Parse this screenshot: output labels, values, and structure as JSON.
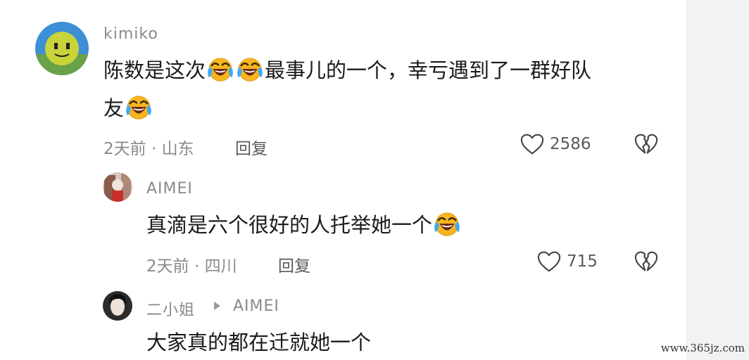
{
  "comments": [
    {
      "username": "kimiko",
      "text_parts": [
        "陈数是这次",
        "最事儿的一个，幸亏遇到了一群好队",
        "友"
      ],
      "meta": "2天前 · 山东",
      "reply_label": "回复",
      "like_count": "2586"
    },
    {
      "username": "AIMEI",
      "text_parts": [
        "真滴是六个很好的人托举她一个"
      ],
      "meta": "2天前 · 四川",
      "reply_label": "回复",
      "like_count": "715"
    },
    {
      "username": "二小姐",
      "reply_to": "AIMEI",
      "text_parts": [
        "大家真的都在迁就她一个"
      ]
    }
  ],
  "watermark": "www.365jz.com",
  "icons": {
    "emoji": "laughing-crying-emoji-icon",
    "like": "heart-outline-icon",
    "dislike": "broken-heart-icon",
    "reply_arrow": "triangle-right-icon"
  }
}
